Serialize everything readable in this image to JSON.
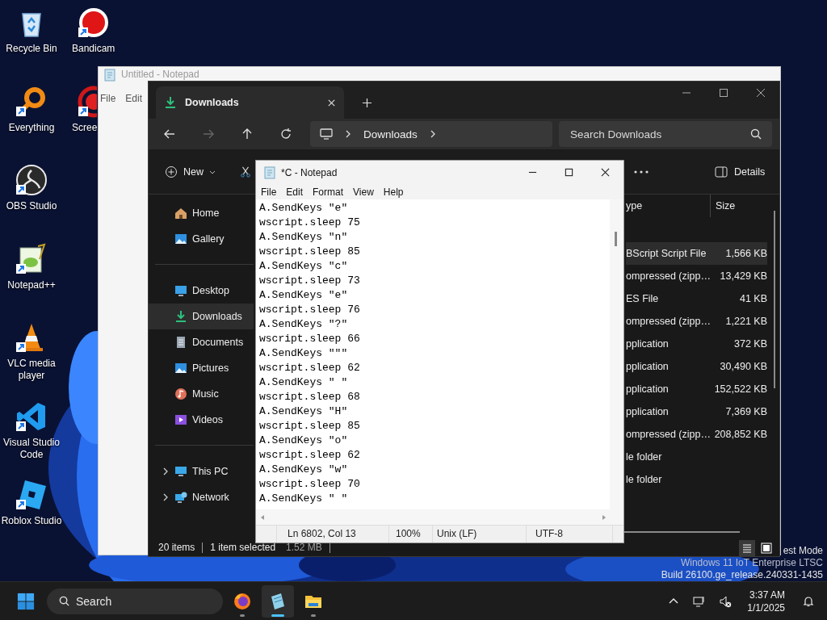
{
  "desktop_columns": [
    [
      {
        "label": "Recycle Bin",
        "kind": "recycle",
        "shortcut": false
      },
      {
        "label": "Everything",
        "kind": "everything",
        "shortcut": true
      },
      {
        "label": "OBS Studio",
        "kind": "obs",
        "shortcut": true
      },
      {
        "label": "Notepad++",
        "kind": "notepadpp",
        "shortcut": true
      },
      {
        "label": "VLC media player",
        "kind": "vlc",
        "shortcut": true
      },
      {
        "label": "Visual Studio Code",
        "kind": "vscode",
        "shortcut": true
      },
      {
        "label": "Roblox Studio",
        "kind": "roblox",
        "shortcut": true
      }
    ],
    [
      {
        "label": "Bandicam",
        "kind": "bandicam",
        "shortcut": true
      },
      {
        "label": "Scree",
        "kind": "record",
        "shortcut": true
      }
    ]
  ],
  "background_window": {
    "title": "Untitled - Notepad",
    "menu": [
      "File",
      "Edit"
    ]
  },
  "explorer": {
    "tab": "Downloads",
    "address": [
      "Downloads"
    ],
    "search": {
      "placeholder": "Search Downloads"
    },
    "toolbar": {
      "new": "New",
      "details": "Details"
    },
    "sidebar": [
      {
        "items": [
          {
            "label": "Home",
            "kind": "home",
            "selected": false,
            "expandable": false
          },
          {
            "label": "Gallery",
            "kind": "gallery",
            "selected": false,
            "expandable": false
          }
        ]
      },
      {
        "items": [
          {
            "label": "Desktop",
            "kind": "desktop",
            "selected": false,
            "expandable": false
          },
          {
            "label": "Downloads",
            "kind": "downloads",
            "selected": true,
            "expandable": false
          },
          {
            "label": "Documents",
            "kind": "documents",
            "selected": false,
            "expandable": false
          },
          {
            "label": "Pictures",
            "kind": "pictures",
            "selected": false,
            "expandable": false
          },
          {
            "label": "Music",
            "kind": "music",
            "selected": false,
            "expandable": false
          },
          {
            "label": "Videos",
            "kind": "videos",
            "selected": false,
            "expandable": false
          }
        ]
      },
      {
        "items": [
          {
            "label": "This PC",
            "kind": "pc",
            "selected": false,
            "expandable": true
          },
          {
            "label": "Network",
            "kind": "network",
            "selected": false,
            "expandable": true
          }
        ]
      }
    ],
    "columns": [
      "ype",
      "Size"
    ],
    "rows": [
      {
        "type": "BScript Script File",
        "size": "1,566 KB",
        "selected": true
      },
      {
        "type": "ompressed (zipp…",
        "size": "13,429 KB",
        "selected": false
      },
      {
        "type": "ES File",
        "size": "41 KB",
        "selected": false
      },
      {
        "type": "ompressed (zipp…",
        "size": "1,221 KB",
        "selected": false
      },
      {
        "type": "pplication",
        "size": "372 KB",
        "selected": false
      },
      {
        "type": "pplication",
        "size": "30,490 KB",
        "selected": false
      },
      {
        "type": "pplication",
        "size": "152,522 KB",
        "selected": false
      },
      {
        "type": "pplication",
        "size": "7,369 KB",
        "selected": false
      },
      {
        "type": "ompressed (zipp…",
        "size": "208,852 KB",
        "selected": false
      },
      {
        "type": "le folder",
        "size": "",
        "selected": false
      },
      {
        "type": "le folder",
        "size": "",
        "selected": false
      }
    ],
    "status": [
      "20 items",
      "1 item selected",
      "1.52 MB"
    ]
  },
  "notepad": {
    "title": "*C - Notepad",
    "menu": [
      "File",
      "Edit",
      "Format",
      "View",
      "Help"
    ],
    "lines": [
      "A.SendKeys \"e\"",
      "wscript.sleep 75",
      "A.SendKeys \"n\"",
      "wscript.sleep 85",
      "A.SendKeys \"c\"",
      "wscript.sleep 73",
      "A.SendKeys \"e\"",
      "wscript.sleep 76",
      "A.SendKeys \"?\"",
      "wscript.sleep 66",
      "A.SendKeys \"\"\"",
      "wscript.sleep 62",
      "A.SendKeys \" \"",
      "wscript.sleep 68",
      "A.SendKeys \"H\"",
      "wscript.sleep 85",
      "A.SendKeys \"o\"",
      "wscript.sleep 62",
      "A.SendKeys \"w\"",
      "wscript.sleep 70",
      "A.SendKeys \" \""
    ],
    "status": [
      "Ln 6802, Col 13",
      "100%",
      "Unix (LF)",
      "UTF-8"
    ]
  },
  "system_text": [
    "est Mode",
    "Windows 11 IoT Enterprise LTSC",
    "Build 26100.ge_release.240331-1435"
  ],
  "taskbar": {
    "search": {
      "placeholder": "Search"
    },
    "apps": [
      {
        "kind": "firefox",
        "active": false
      },
      {
        "kind": "notepad",
        "active": true
      },
      {
        "kind": "folder",
        "active": false
      }
    ],
    "time": "3:37 AM",
    "date": "1/1/2025"
  }
}
